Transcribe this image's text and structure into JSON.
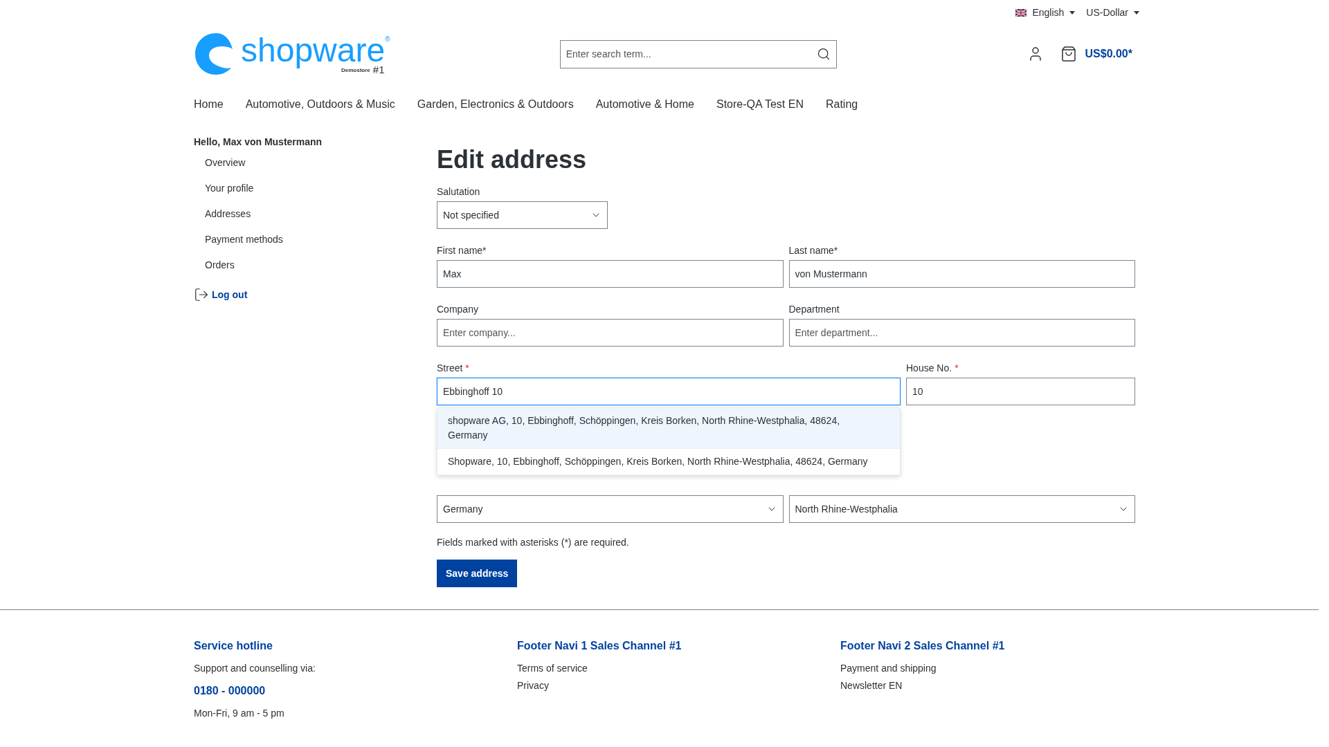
{
  "topbar": {
    "language": "English",
    "currency": "US-Dollar"
  },
  "logo": {
    "wordmark": "shopware",
    "registered": "®",
    "tag": "Demostore",
    "number": "#1"
  },
  "search": {
    "placeholder": "Enter search term..."
  },
  "cart": {
    "total": "US$0.00*"
  },
  "nav": [
    {
      "label": "Home"
    },
    {
      "label": "Automotive, Outdoors & Music"
    },
    {
      "label": "Garden, Electronics & Outdoors"
    },
    {
      "label": "Automotive & Home"
    },
    {
      "label": "Store-QA Test EN"
    },
    {
      "label": "Rating"
    }
  ],
  "sidebar": {
    "greeting": "Hello, Max von Mustermann",
    "items": [
      {
        "label": "Overview"
      },
      {
        "label": "Your profile"
      },
      {
        "label": "Addresses"
      },
      {
        "label": "Payment methods"
      },
      {
        "label": "Orders"
      }
    ],
    "logout": "Log out"
  },
  "form": {
    "title": "Edit address",
    "salutation": {
      "label": "Salutation",
      "value": "Not specified"
    },
    "first_name": {
      "label": "First name*",
      "value": "Max"
    },
    "last_name": {
      "label": "Last name*",
      "value": "von Mustermann"
    },
    "company": {
      "label": "Company",
      "placeholder": "Enter company..."
    },
    "department": {
      "label": "Department",
      "placeholder": "Enter department..."
    },
    "street": {
      "label": "Street",
      "required_mark": "*",
      "value": "Ebbinghoff 10",
      "focused": true
    },
    "house_no": {
      "label": "House No.",
      "required_mark": "*",
      "value": "10",
      "focused": false
    },
    "suggestions": [
      {
        "text": "shopware AG, 10, Ebbinghoff, Schöppingen, Kreis Borken, North Rhine-Westphalia, 48624, Germany",
        "selected": true
      },
      {
        "text": "Shopware, 10, Ebbinghoff, Schöppingen, Kreis Borken, North Rhine-Westphalia, 48624, Germany",
        "selected": false
      }
    ],
    "country": {
      "value": "Germany"
    },
    "state": {
      "value": "North Rhine-Westphalia"
    },
    "note": "Fields marked with asterisks (*) are required.",
    "save": "Save address"
  },
  "footer": {
    "columns": [
      {
        "title": "Service hotline",
        "lines": [
          {
            "kind": "text",
            "text": "Support and counselling via:"
          },
          {
            "kind": "phone",
            "text": "0180 - 000000"
          },
          {
            "kind": "text",
            "text": "Mon-Fri, 9 am - 5 pm"
          }
        ]
      },
      {
        "title": "Footer Navi 1 Sales Channel #1",
        "lines": [
          {
            "kind": "link",
            "text": "Terms of service"
          },
          {
            "kind": "link",
            "text": "Privacy"
          }
        ]
      },
      {
        "title": "Footer Navi 2 Sales Channel #1",
        "lines": [
          {
            "kind": "link",
            "text": "Payment and shipping"
          },
          {
            "kind": "link",
            "text": "Newsletter EN"
          }
        ]
      }
    ]
  }
}
